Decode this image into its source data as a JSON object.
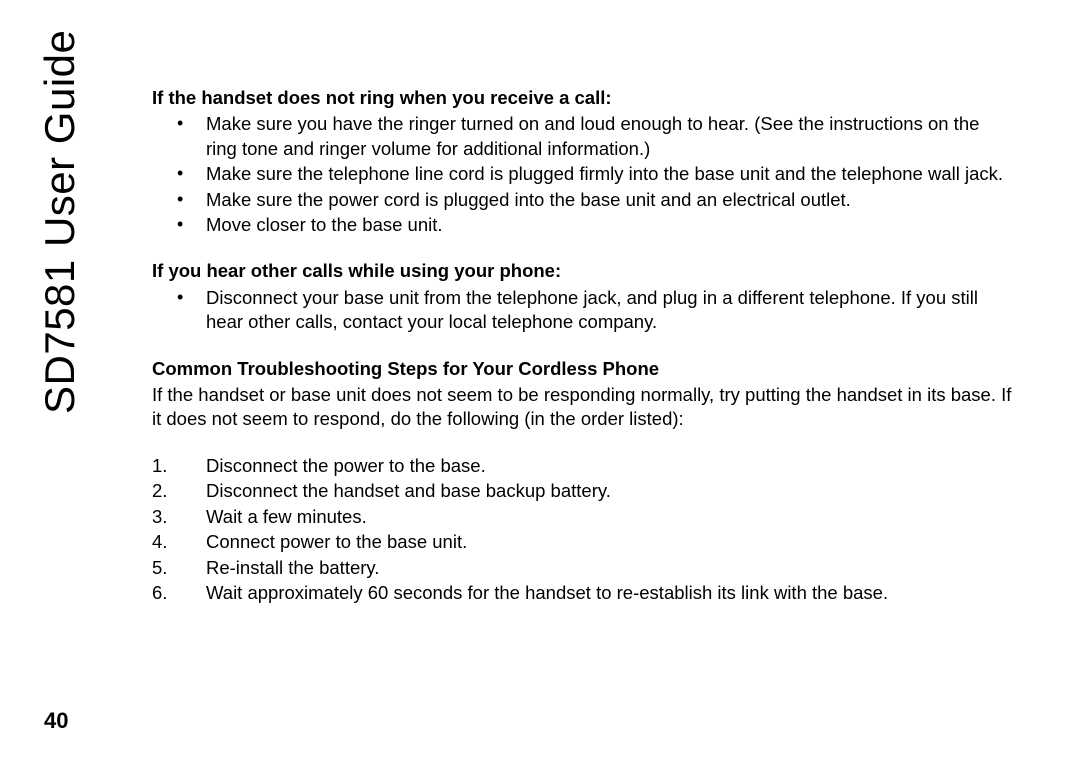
{
  "sideTitle": "SD7581 User Guide",
  "pageNumber": "40",
  "section1": {
    "heading": "If the handset does not ring when you receive a call:",
    "bullets": [
      "Make sure you have the ringer turned on and loud enough to hear. (See the instructions on the ring tone and ringer volume for additional information.)",
      "Make sure the telephone line cord is plugged firmly into the base unit and the telephone wall jack.",
      "Make sure the power cord is plugged into the base unit and an electrical outlet.",
      "Move closer to the base unit."
    ]
  },
  "section2": {
    "heading": "If you hear other calls while using your phone:",
    "bullets": [
      "Disconnect your base unit from the telephone jack, and plug in a different telephone. If you still hear other calls, contact your local telephone company."
    ]
  },
  "section3": {
    "heading": "Common Troubleshooting Steps for Your Cordless Phone",
    "para": "If the handset or base unit does not seem to be responding normally, try putting the handset in its base. If it does not seem to respond, do the following (in the order listed):",
    "steps": [
      "Disconnect the power to the base.",
      "Disconnect the handset and base backup battery.",
      "Wait a few minutes.",
      "Connect power to the base unit.",
      "Re-install the battery.",
      "Wait approximately 60 seconds for the handset to re-establish its link with the base."
    ]
  }
}
